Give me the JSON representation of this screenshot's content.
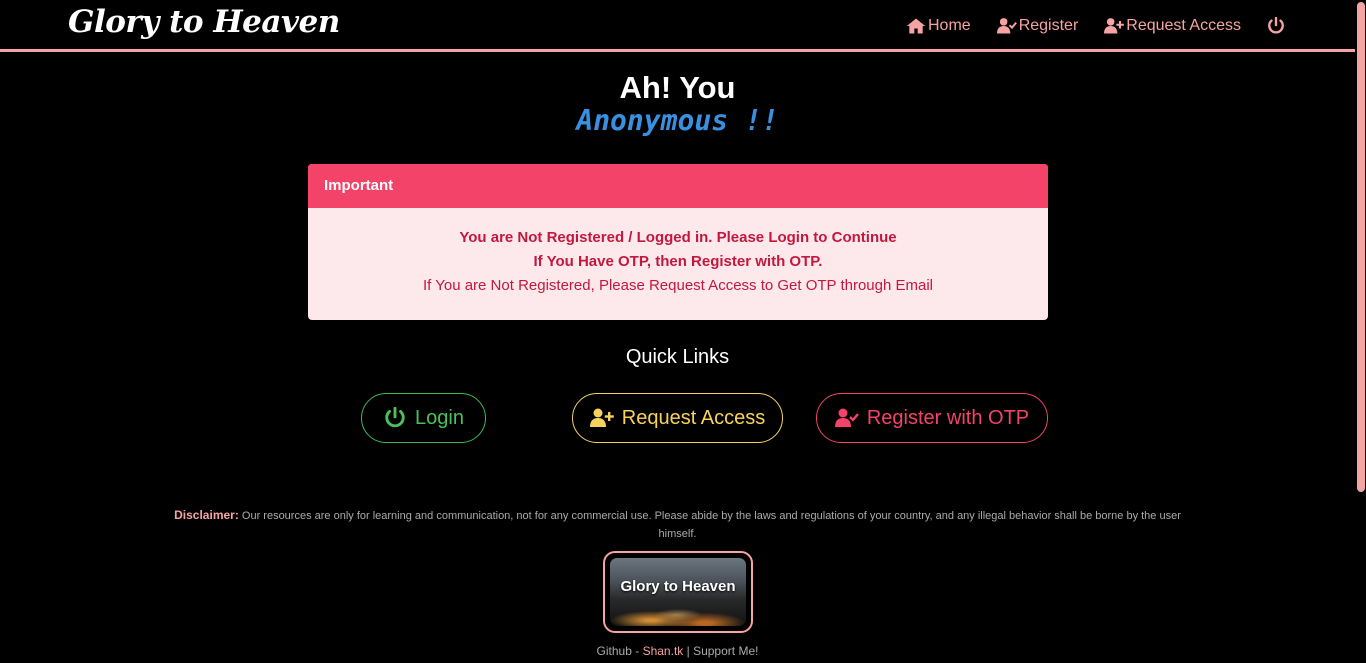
{
  "nav": {
    "brand": "Glory to Heaven",
    "links": [
      {
        "label": "Home",
        "icon": "home-icon"
      },
      {
        "label": "Register",
        "icon": "user-check-icon"
      },
      {
        "label": "Request Access",
        "icon": "user-plus-icon"
      }
    ],
    "power_icon": "power-icon"
  },
  "greeting": {
    "line1": "Ah! You",
    "line2": "Anonymous !!"
  },
  "alert": {
    "header": "Important",
    "line1": "You are Not Registered / Logged in. Please Login to Continue",
    "line2": "If You Have OTP, then Register with OTP.",
    "line3": "If You are Not Registered, Please Request Access to Get OTP through Email"
  },
  "quick_links": {
    "title": "Quick Links",
    "buttons": [
      {
        "label": "Login",
        "icon": "power-icon",
        "color": "#4cc05a"
      },
      {
        "label": "Request Access",
        "icon": "user-plus-icon",
        "color": "#f7d35c"
      },
      {
        "label": "Register with OTP",
        "icon": "user-check-icon",
        "color": "#f34369"
      }
    ]
  },
  "disclaimer": {
    "label": "Disclaimer:",
    "text": "Our resources are only for learning and communication, not for any commercial use. Please abide by the laws and regulations of your country, and any illegal behavior shall be borne by the user himself."
  },
  "logo_text": "Glory to Heaven",
  "footer": {
    "prefix": "Github - ",
    "link": "Shan.tk",
    "separator": " | ",
    "support": "Support Me!"
  },
  "colors": {
    "accent": "#f5a3a3",
    "alert_header": "#f34369",
    "anonymous": "#3a90e0"
  }
}
